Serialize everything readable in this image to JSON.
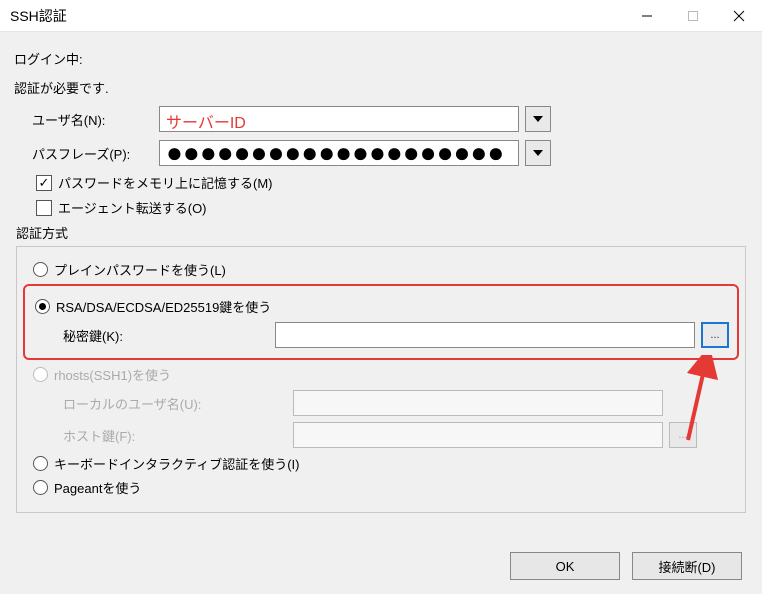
{
  "title": "SSH認証",
  "status": {
    "login_prefix": "ログイン中:"
  },
  "msg_auth_required": "認証が必要です.",
  "fields": {
    "username_label": "ユーザ名(N):",
    "username_value": "サーバーID",
    "passphrase_label": "パスフレーズ(P):",
    "passphrase_masked": "●●●●●●●●●●●●●●●●●●●●"
  },
  "checkboxes": {
    "remember_password": {
      "label": "パスワードをメモリ上に記憶する(M)",
      "checked": true
    },
    "agent_forward": {
      "label": "エージェント転送する(O)",
      "checked": false
    }
  },
  "auth_section_label": "認証方式",
  "radios": {
    "plain_password": "プレインパスワードを使う(L)",
    "rsa_key": "RSA/DSA/ECDSA/ED25519鍵を使う",
    "rhosts": "rhosts(SSH1)を使う",
    "keyboard_interactive": "キーボードインタラクティブ認証を使う(I)",
    "pageant": "Pageantを使う"
  },
  "key": {
    "private_key_label": "秘密鍵(K):",
    "private_key_value": "",
    "browse_label": "..."
  },
  "rhosts_fields": {
    "local_user_label": "ローカルのユーザ名(U):",
    "host_key_label": "ホスト鍵(F):",
    "browse_label": "..."
  },
  "buttons": {
    "ok": "OK",
    "disconnect": "接続断(D)"
  }
}
